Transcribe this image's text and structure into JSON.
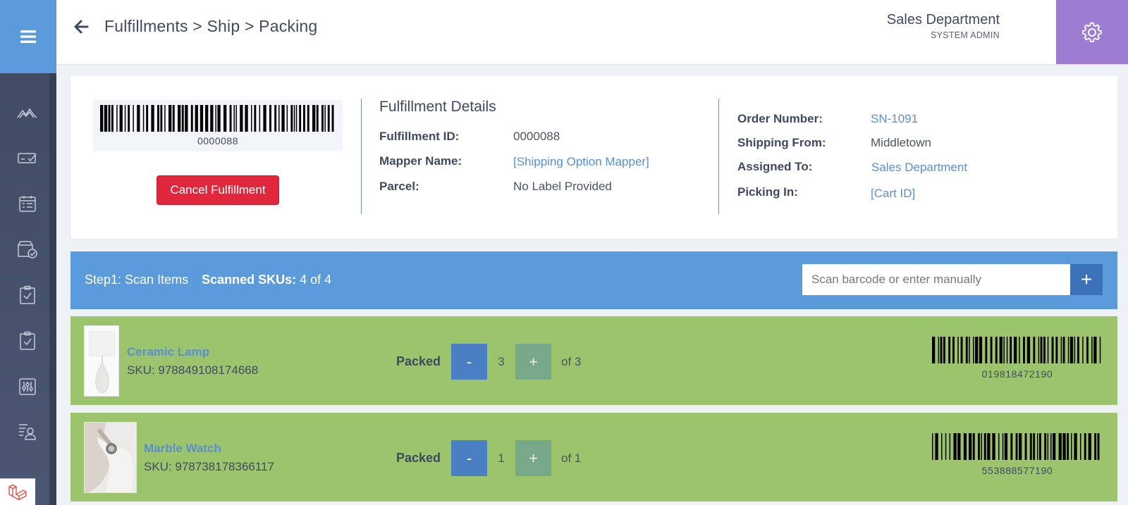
{
  "header": {
    "breadcrumb": "Fulfillments > Ship > Packing",
    "user_name": "Sales Department",
    "user_role": "SYSTEM ADMIN"
  },
  "sidebar": {
    "icons": [
      "dashboard-icon",
      "payment-icon",
      "calendar-icon",
      "box-check-icon",
      "clipboard-check-icon",
      "clipboard-check-icon",
      "sliders-icon",
      "user-list-icon"
    ]
  },
  "fulfillment": {
    "barcode_number": "0000088",
    "cancel_label": "Cancel Fulfillment",
    "section_title": "Fulfillment Details",
    "fields": {
      "id_label": "Fulfillment ID:",
      "id_value": "0000088",
      "mapper_label": "Mapper Name:",
      "mapper_value": "[Shipping Option Mapper]",
      "parcel_label": "Parcel:",
      "parcel_value": "No Label Provided"
    },
    "order": {
      "order_label": "Order Number:",
      "order_value": "SN-1091",
      "shipping_label": "Shipping From:",
      "shipping_value": "Middletown",
      "assigned_label": "Assigned To:",
      "assigned_value": "Sales Department",
      "picking_label": "Picking In:",
      "picking_value": "[Cart ID]"
    }
  },
  "step": {
    "title": "Step1: Scan Items",
    "scanned_label": "Scanned SKUs:",
    "scanned_value": "4 of 4",
    "scan_placeholder": "Scan barcode or enter manually",
    "add_label": "+"
  },
  "items": [
    {
      "name": "Ceramic Lamp",
      "sku": "SKU: 978849108174668",
      "packed_label": "Packed",
      "minus": "-",
      "qty": "3",
      "plus": "+",
      "of": "of 3",
      "barcode": "019818472190"
    },
    {
      "name": "Marble Watch",
      "sku": "SKU: 978738178366117",
      "packed_label": "Packed",
      "minus": "-",
      "qty": "1",
      "plus": "+",
      "of": "of 1",
      "barcode": "553888577190"
    }
  ],
  "colors": {
    "primary": "#5b9bdb",
    "settings": "#9d7dd2",
    "danger": "#e0273b",
    "row_success": "#9cc46c",
    "link": "#5b8fd0"
  }
}
